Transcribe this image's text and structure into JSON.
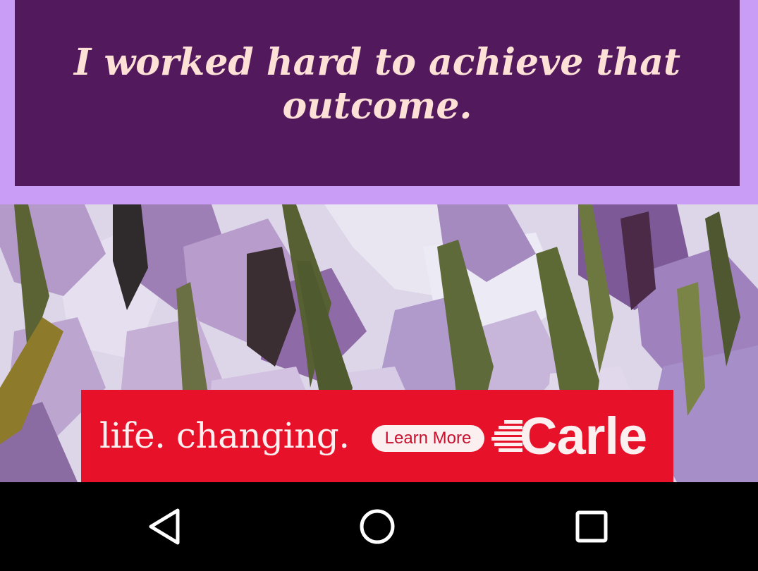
{
  "quote": {
    "text": "I worked hard to achieve that outcome."
  },
  "background": {
    "icon": "painted-flowers-background"
  },
  "ad": {
    "tagline": "life. changing.",
    "button_label": "Learn More",
    "brand_name": "Carle",
    "colors": {
      "background": "#e8112a",
      "foreground": "#fbeff0",
      "button_text": "#c8102e"
    }
  },
  "nav_bar": {
    "back_icon": "back-triangle-icon",
    "home_icon": "home-circle-icon",
    "recents_icon": "recents-square-icon"
  },
  "colors": {
    "quote_card": "#521a5c",
    "quote_frame": "#c99cf6",
    "quote_text": "#fde0d6",
    "nav_background": "#000000"
  }
}
